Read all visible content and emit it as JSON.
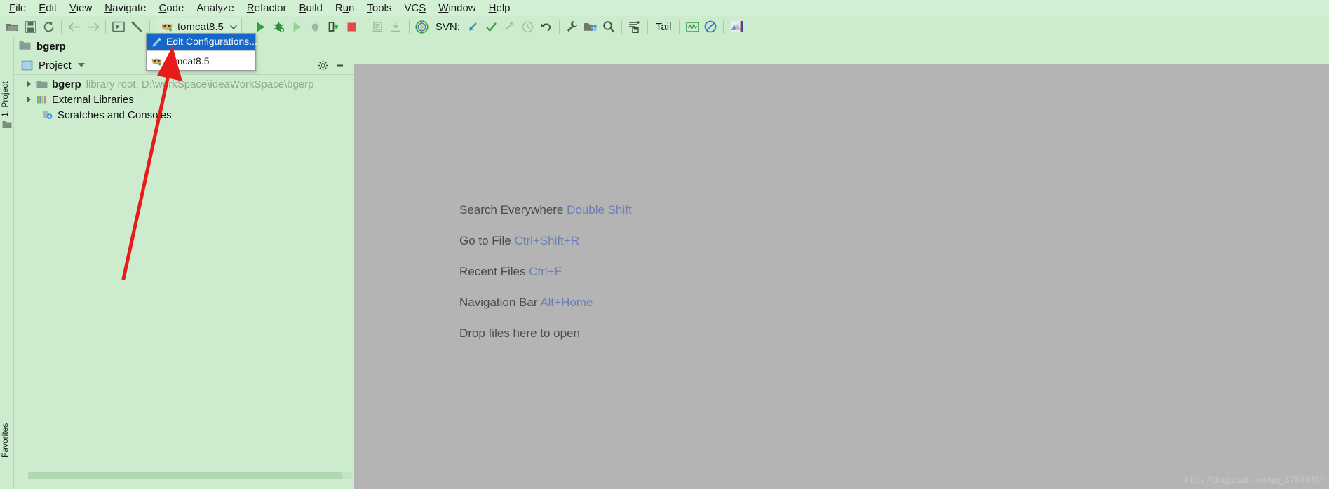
{
  "window": {
    "title": "bgerp"
  },
  "menubar": {
    "items": [
      {
        "label": "File"
      },
      {
        "label": "Edit"
      },
      {
        "label": "View"
      },
      {
        "label": "Navigate"
      },
      {
        "label": "Code"
      },
      {
        "label": "Analyze"
      },
      {
        "label": "Refactor"
      },
      {
        "label": "Build"
      },
      {
        "label": "Run"
      },
      {
        "label": "Tools"
      },
      {
        "label": "VCS"
      },
      {
        "label": "Window"
      },
      {
        "label": "Help"
      }
    ]
  },
  "toolbar": {
    "open_icon": "open-folder-icon",
    "save_icon": "save-icon",
    "sync_icon": "sync-icon",
    "back_icon": "arrow-left-icon",
    "forward_icon": "arrow-right-icon",
    "toggle_icon": "toggle-panel-icon",
    "build_icon": "hammer-icon",
    "run_config_label": "tomcat8.5",
    "run_config_icon": "tomcat-icon",
    "run_config_caret": "chevron-down-icon",
    "run_icon": "run-icon",
    "debug_icon": "debug-icon",
    "run_coverage_icon": "run-with-coverage-icon",
    "profile_icon": "profile-icon",
    "rerun_icon": "rerun-icon",
    "stop_icon": "stop-icon",
    "deploy_icon": "deploy-icon",
    "attach_icon": "attach-icon",
    "svn_update_group_icon": "svn-logo-icon",
    "svn_label": "SVN:",
    "svn_update_icon": "update-project-icon",
    "svn_commit_icon": "commit-check-icon",
    "svn_push_icon": "push-icon",
    "svn_history_icon": "history-clock-icon",
    "svn_revert_icon": "revert-icon",
    "settings_icon": "wrench-icon",
    "project-structure_icon": "project-structure-icon",
    "search_icon": "search-icon",
    "save-all_icon": "save-all-icon",
    "tail_label": "Tail",
    "monitor_icon": "monitor-graph-icon",
    "block_icon": "no-entry-icon",
    "app_icon": "application-icon"
  },
  "dropdown": {
    "items": [
      {
        "label": "Edit Configurations...",
        "icon": "edit-configurations-icon",
        "selected": true
      },
      {
        "label": "tomcat8.5",
        "icon": "tomcat-icon",
        "selected": false
      }
    ]
  },
  "sidebar": {
    "tabs": [
      {
        "label": "1: Project"
      },
      {
        "label": "Favorites"
      }
    ]
  },
  "project_panel": {
    "title": "bgerp",
    "title_icon": "module-folder-icon",
    "header_label": "Project",
    "header_caret": "chevron-down-icon",
    "settings_icon": "panel-settings-icon",
    "collapse_icon": "minimize-icon",
    "tree": [
      {
        "label": "bgerp",
        "sub": "library root,  D:\\workSpace\\ideaWorkSpace\\bgerp",
        "icon": "module-folder-icon",
        "has_arrow": true,
        "indent": 1
      },
      {
        "label": "External Libraries",
        "sub": "",
        "icon": "libraries-icon",
        "has_arrow": true,
        "indent": 1
      },
      {
        "label": "Scratches and Consoles",
        "sub": "",
        "icon": "scratches-icon",
        "has_arrow": false,
        "indent": 2
      }
    ]
  },
  "editor": {
    "welcome_lines": [
      {
        "text": "Search Everywhere",
        "shortcut": "Double Shift"
      },
      {
        "text": "Go to File",
        "shortcut": "Ctrl+Shift+R"
      },
      {
        "text": "Recent Files",
        "shortcut": "Ctrl+E"
      },
      {
        "text": "Navigation Bar",
        "shortcut": "Alt+Home"
      },
      {
        "text": "Drop files here to open",
        "shortcut": ""
      }
    ],
    "watermark": "https://blog.csdn.net/qq_37844454"
  },
  "colors": {
    "menubar_bg": "#d4f0d4",
    "toolbar_bg": "#cdeccd",
    "editor_bg": "#b4b4b4",
    "selection_blue": "#1668c8",
    "shortcut_blue": "#6a7fb5",
    "annotation_red": "#e81b1b"
  },
  "annotation": {
    "arrow": "red-pointer-arrow"
  }
}
